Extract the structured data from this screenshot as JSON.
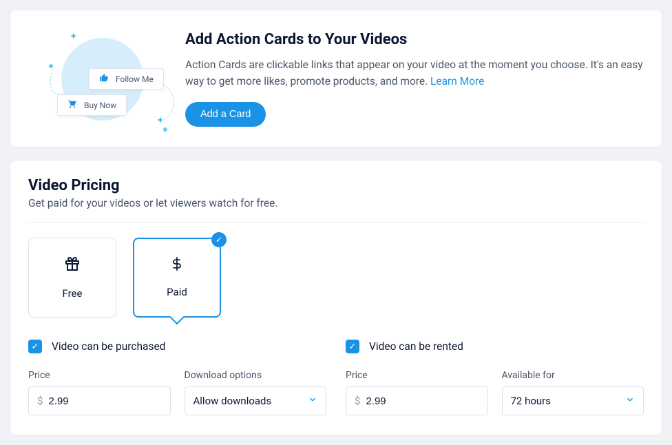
{
  "action_cards": {
    "title": "Add Action Cards to Your Videos",
    "description": "Action Cards are clickable links that appear on your video at the moment you choose. It's an easy way to get more likes, promote products, and more. ",
    "learn_more_label": "Learn More",
    "add_label": "Add a Card",
    "illustration": {
      "follow_label": "Follow Me",
      "buy_label": "Buy Now"
    }
  },
  "pricing": {
    "title": "Video Pricing",
    "subtitle": "Get paid for your videos or let viewers watch for free.",
    "plans": {
      "free_label": "Free",
      "paid_label": "Paid"
    },
    "purchase": {
      "checkbox_label": "Video can be purchased",
      "price_label": "Price",
      "price_currency": "$",
      "price_value": "2.99",
      "download_label": "Download options",
      "download_value": "Allow downloads"
    },
    "rent": {
      "checkbox_label": "Video can be rented",
      "price_label": "Price",
      "price_currency": "$",
      "price_value": "2.99",
      "available_label": "Available for",
      "available_value": "72 hours"
    }
  }
}
